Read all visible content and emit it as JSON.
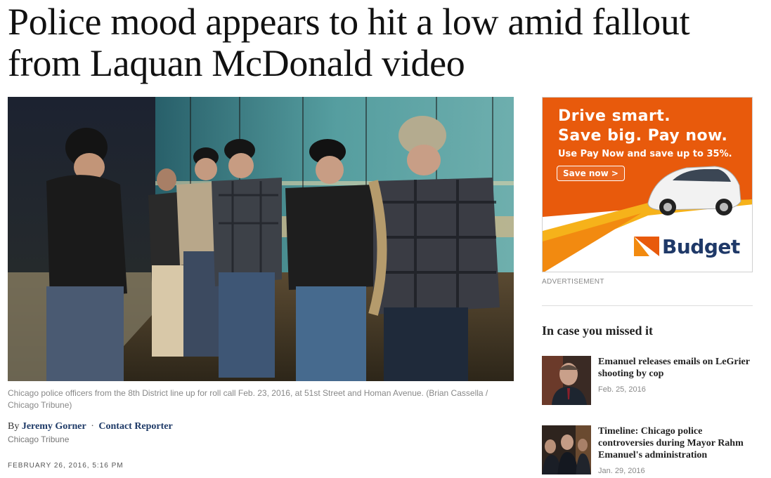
{
  "article": {
    "headline": "Police mood appears to hit a low amid fallout from Laquan McDonald video",
    "caption": "Chicago police officers from the 8th District line up for roll call Feb. 23, 2016, at 51st Street and Homan Avenue. (Brian Cassella / Chicago Tribune)",
    "byline_prefix": "By",
    "author": "Jeremy Gorner",
    "separator": "·",
    "contact_label": "Contact Reporter",
    "source": "Chicago Tribune",
    "date": "FEBRUARY 26, 2016, 5:16 PM"
  },
  "ad": {
    "line1": "Drive smart.",
    "line2": "Save big. Pay now.",
    "line3": "Use Pay Now and save up to 35%.",
    "cta": "Save now >",
    "brand": "Budget",
    "label": "ADVERTISEMENT",
    "colors": {
      "orange": "#e85a0c",
      "yellow": "#f6b21a",
      "navy": "#1f3968"
    }
  },
  "sidebar": {
    "title": "In case you missed it",
    "stories": [
      {
        "title": "Emanuel releases emails on LeGrier shooting by cop",
        "date": "Feb. 25, 2016"
      },
      {
        "title": "Timeline: Chicago police controversies during Mayor Rahm Emanuel's administration",
        "date": "Jan. 29, 2016"
      }
    ]
  }
}
